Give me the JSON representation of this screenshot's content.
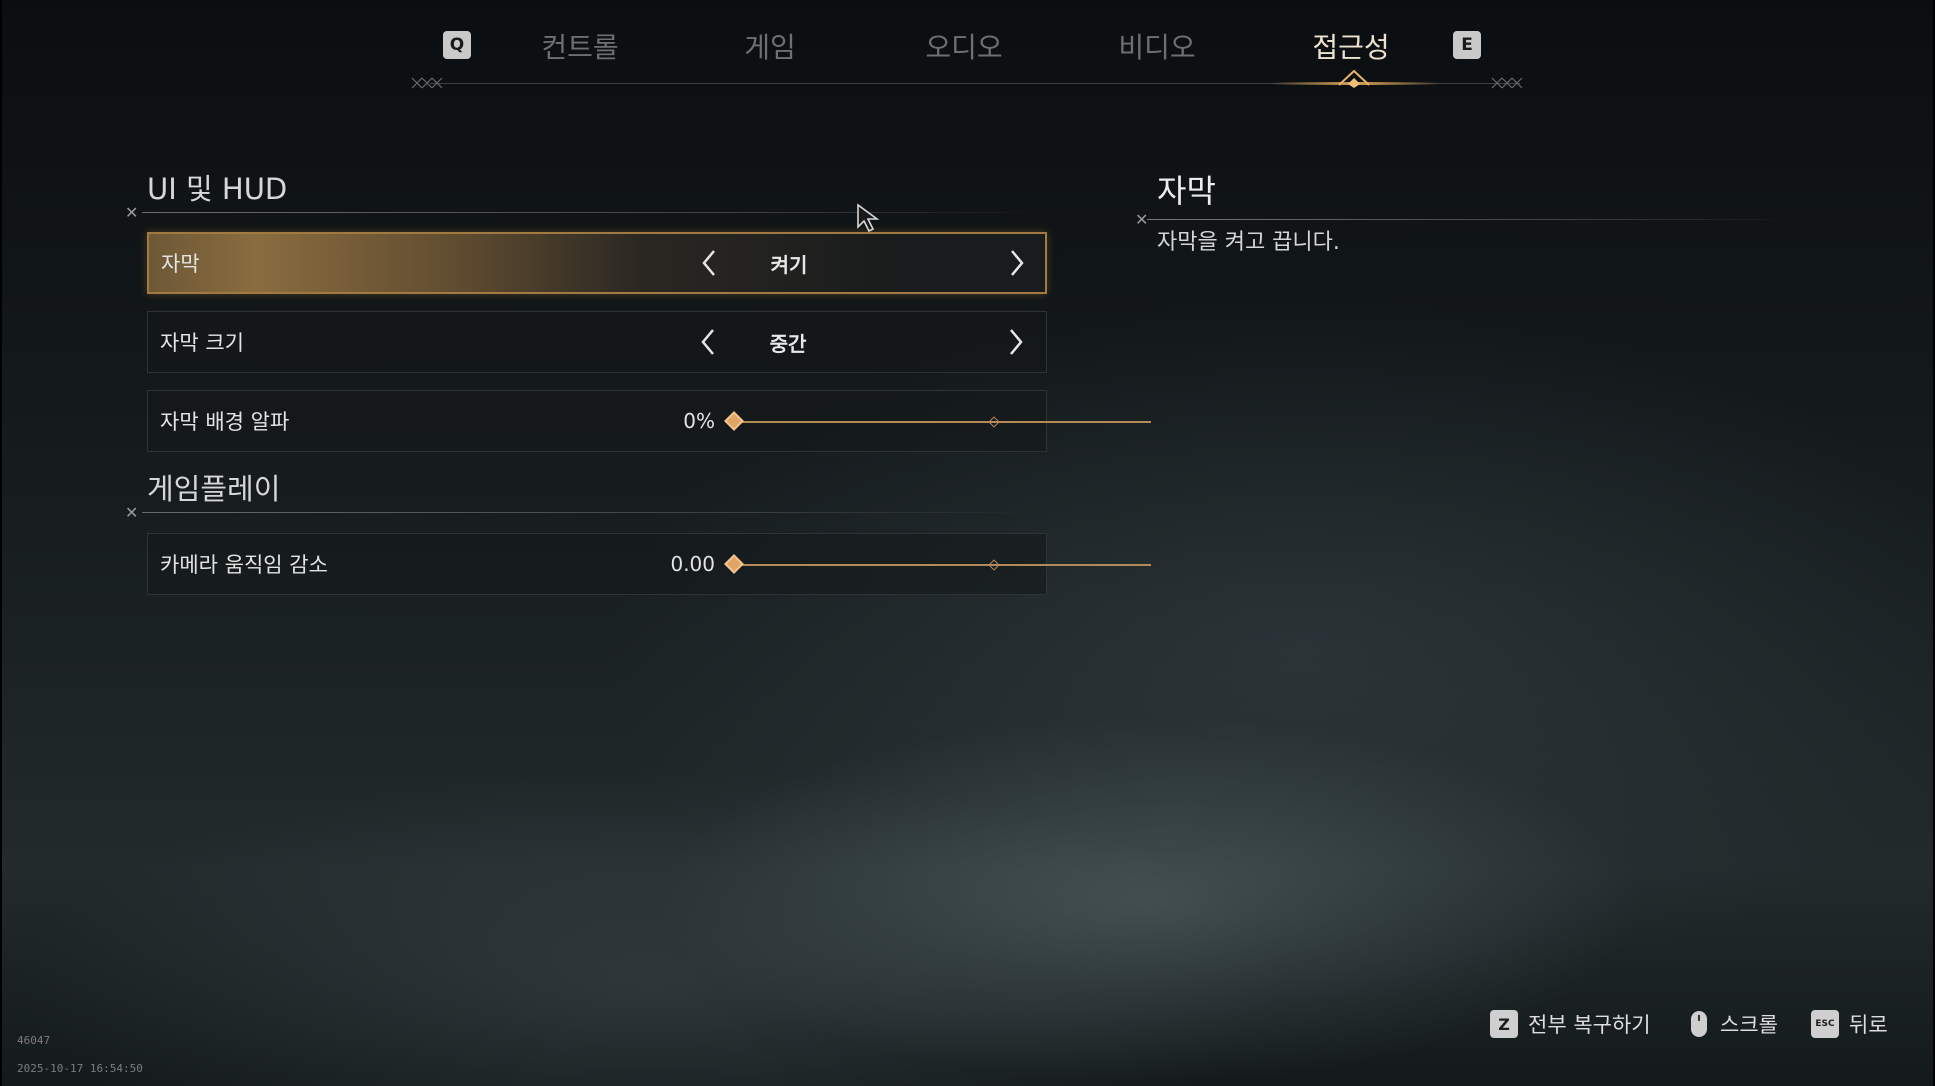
{
  "tabs": {
    "prev_key": "Q",
    "next_key": "E",
    "items": [
      {
        "label": "컨트롤"
      },
      {
        "label": "게임"
      },
      {
        "label": "오디오"
      },
      {
        "label": "비디오"
      },
      {
        "label": "접근성",
        "active": true
      }
    ]
  },
  "sections": {
    "ui_hud": {
      "title": "UI 및 HUD",
      "rows": [
        {
          "label": "자막",
          "value": "켜기",
          "selected": true
        },
        {
          "label": "자막 크기",
          "value": "중간"
        },
        {
          "label": "자막 배경 알파",
          "value": "0%",
          "slider_fraction": 0.0
        }
      ]
    },
    "gameplay": {
      "title": "게임플레이",
      "rows": [
        {
          "label": "카메라 움직임 감소",
          "value": "0.00",
          "slider_fraction": 0.0
        }
      ]
    }
  },
  "description": {
    "title": "자막",
    "text": "자막을 켜고 끕니다."
  },
  "footer": {
    "reset": {
      "key": "Z",
      "label": "전부 복구하기"
    },
    "scroll": {
      "icon": "mouse-icon",
      "label": "스크롤"
    },
    "back": {
      "key": "ESC",
      "label": "뒤로"
    }
  },
  "meta": {
    "id": "46047",
    "timestamp": "2025-10-17 16:54:50"
  },
  "colors": {
    "accent": "#d9a055",
    "selected_border": "#a17a41",
    "slider": "#b48a57"
  }
}
